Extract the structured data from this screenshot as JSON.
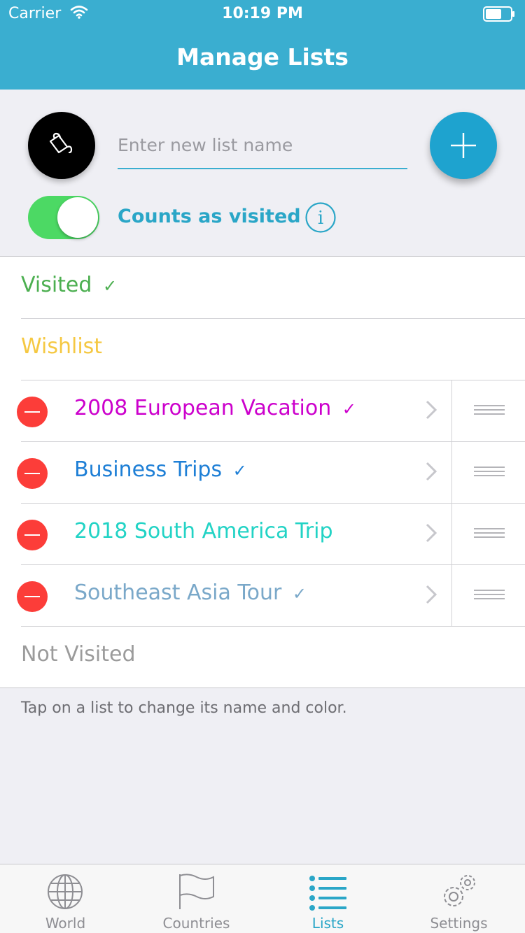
{
  "status_bar": {
    "carrier": "Carrier",
    "time": "10:19 PM"
  },
  "header": {
    "title": "Manage Lists"
  },
  "new_list": {
    "placeholder": "Enter new list name",
    "toggle_on": true,
    "toggle_label": "Counts as visited"
  },
  "lists": {
    "visited": {
      "label": "Visited",
      "check": "✓",
      "color": "#4caf50"
    },
    "wishlist": {
      "label": "Wishlist",
      "color": "#f5c842"
    },
    "custom": [
      {
        "label": "2008 European Vacation",
        "check": "✓",
        "color": "#cc00cc"
      },
      {
        "label": "Business Trips",
        "check": "✓",
        "color": "#1e7fd6"
      },
      {
        "label": "2018 South America Trip",
        "check": "",
        "color": "#22d3c5"
      },
      {
        "label": "Southeast Asia Tour",
        "check": "✓",
        "color": "#7aa8c9"
      }
    ],
    "not_visited": {
      "label": "Not Visited",
      "color": "#9b9b9b"
    }
  },
  "footer_note": "Tap on a list to change its name and color.",
  "tabbar": {
    "tabs": [
      {
        "label": "World",
        "icon": "globe-icon"
      },
      {
        "label": "Countries",
        "icon": "flag-icon"
      },
      {
        "label": "Lists",
        "icon": "list-icon",
        "active": true
      },
      {
        "label": "Settings",
        "icon": "gear-icon"
      }
    ]
  },
  "colors": {
    "accent": "#3aaed0",
    "add_button": "#1ea3cf",
    "toggle": "#4cd964",
    "delete": "#fc3d39"
  }
}
